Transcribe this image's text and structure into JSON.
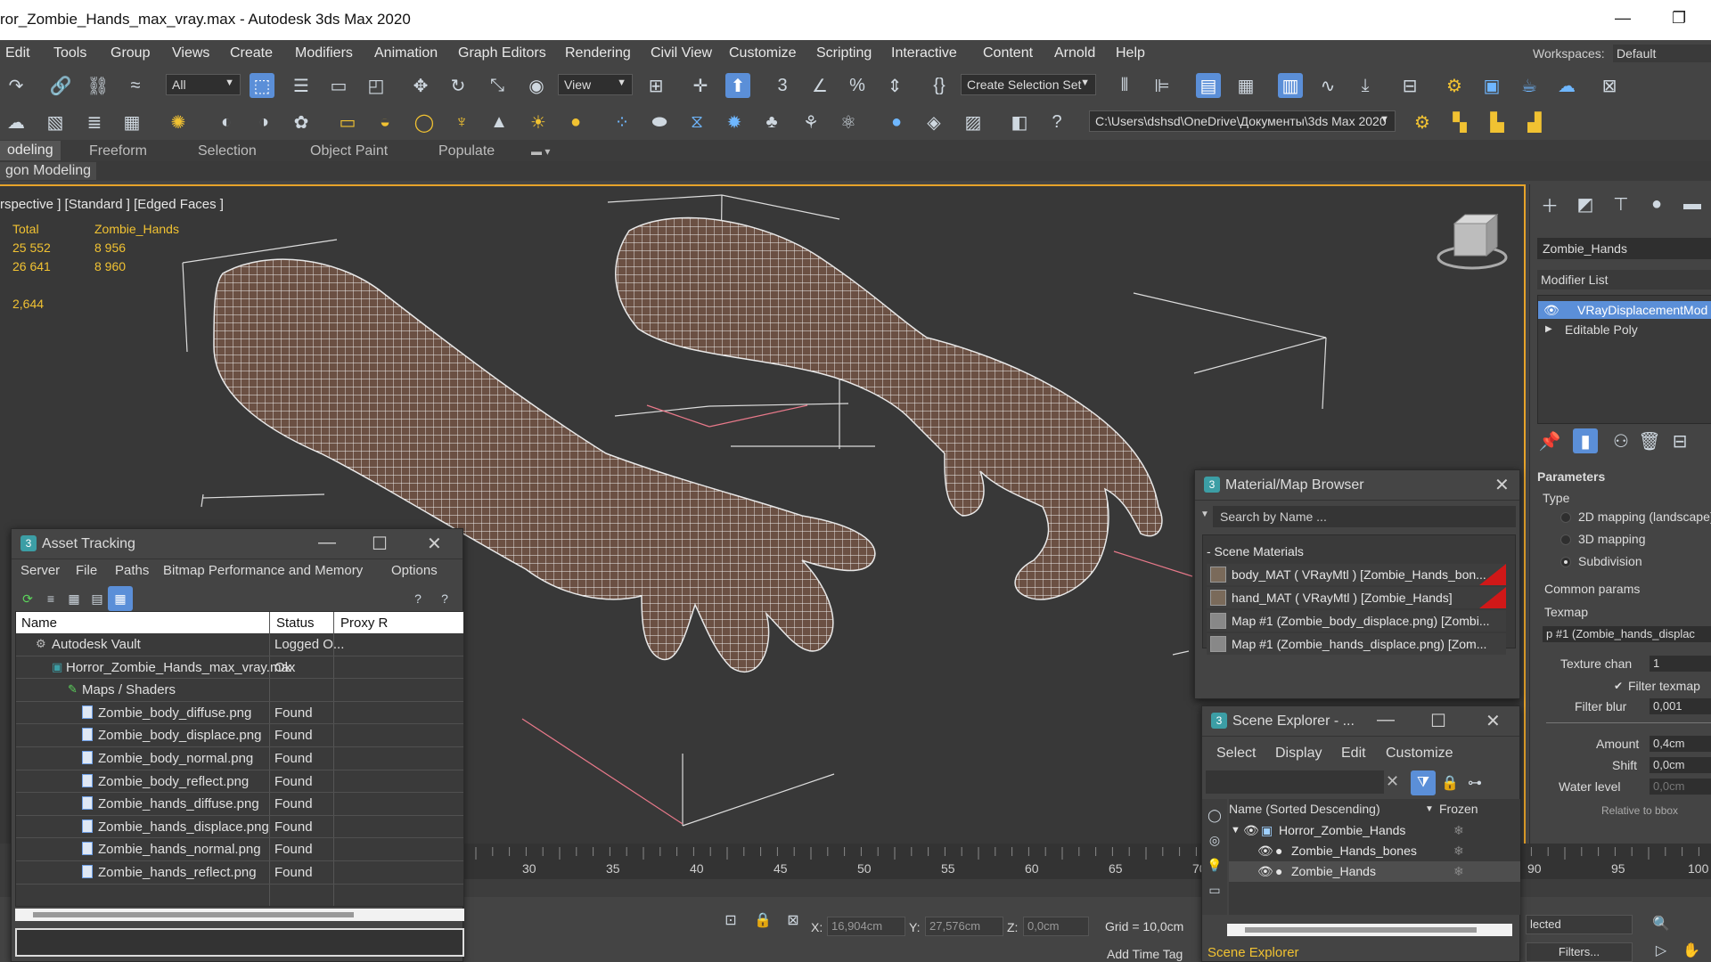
{
  "window": {
    "title": "ror_Zombie_Hands_max_vray.max - Autodesk 3ds Max 2020",
    "minimize": "—",
    "restore": "❐"
  },
  "menu": {
    "items": [
      "Edit",
      "Tools",
      "Group",
      "Views",
      "Create",
      "Modifiers",
      "Animation",
      "Graph Editors",
      "Rendering",
      "Civil View",
      "Customize",
      "Scripting",
      "Interactive",
      "Content",
      "Arnold",
      "Help"
    ],
    "workspaces_label": "Workspaces:",
    "workspaces_value": "Default"
  },
  "toolbar": {
    "filter_select": "All",
    "view_select": "View",
    "selection_set": "Create Selection Set",
    "project_path": "C:\\Users\\dshsd\\OneDrive\\Документы\\3ds Max 2020"
  },
  "ribbon": {
    "tabs": [
      "odeling",
      "Freeform",
      "Selection",
      "Object Paint",
      "Populate"
    ],
    "sub_label": "gon Modeling"
  },
  "viewport": {
    "label": "rspective ] [Standard ] [Edged Faces ]",
    "stats": {
      "col1_header": "Total",
      "col2_header": "Zombie_Hands",
      "row1_total": "25 552",
      "row1_obj": "8 956",
      "row2_total": "26 641",
      "row2_obj": "8 960",
      "fps": "2,644"
    }
  },
  "command_panel": {
    "object_name": "Zombie_Hands",
    "modifier_list": "Modifier List",
    "stack": [
      "VRayDisplacementMod",
      "Editable Poly"
    ],
    "parameters_title": "Parameters",
    "type_label": "Type",
    "type_options": [
      "2D mapping (landscape)",
      "3D mapping",
      "Subdivision"
    ],
    "common_params": "Common params",
    "texmap_label": "Texmap",
    "texmap_value": "p #1 (Zombie_hands_displac",
    "texture_chan_label": "Texture chan",
    "texture_chan_value": "1",
    "filter_texmap": "Filter texmap",
    "filter_blur_label": "Filter blur",
    "filter_blur_value": "0,001",
    "amount_label": "Amount",
    "amount_value": "0,4cm",
    "shift_label": "Shift",
    "shift_value": "0,0cm",
    "water_level_label": "Water level",
    "water_level_value": "0,0cm",
    "relative_label": "Relative to bbox"
  },
  "asset_tracking": {
    "title": "Asset Tracking",
    "menu": [
      "Server",
      "File",
      "Paths",
      "Bitmap Performance and Memory",
      "Options"
    ],
    "columns": [
      "Name",
      "Status",
      "Proxy R"
    ],
    "rows": [
      {
        "name": "Autodesk Vault",
        "status": "Logged O..."
      },
      {
        "name": "Horror_Zombie_Hands_max_vray.max",
        "status": "Ok"
      },
      {
        "name": "Maps / Shaders",
        "status": ""
      },
      {
        "name": "Zombie_body_diffuse.png",
        "status": "Found"
      },
      {
        "name": "Zombie_body_displace.png",
        "status": "Found"
      },
      {
        "name": "Zombie_body_normal.png",
        "status": "Found"
      },
      {
        "name": "Zombie_body_reflect.png",
        "status": "Found"
      },
      {
        "name": "Zombie_hands_diffuse.png",
        "status": "Found"
      },
      {
        "name": "Zombie_hands_displace.png",
        "status": "Found"
      },
      {
        "name": "Zombie_hands_normal.png",
        "status": "Found"
      },
      {
        "name": "Zombie_hands_reflect.png",
        "status": "Found"
      }
    ]
  },
  "material_browser": {
    "title": "Material/Map Browser",
    "search_placeholder": "Search by Name ...",
    "group": "- Scene Materials",
    "rows": [
      "body_MAT  ( VRayMtl )  [Zombie_Hands_bon...",
      "hand_MAT  ( VRayMtl )  [Zombie_Hands]",
      "Map  #1  (Zombie_body_displace.png)   [Zombi...",
      "Map  #1  (Zombie_hands_displace.png)   [Zom..."
    ]
  },
  "scene_explorer": {
    "title": "Scene Explorer - ...",
    "menu": [
      "Select",
      "Display",
      "Edit",
      "Customize"
    ],
    "col_name": "Name (Sorted Descending)",
    "col_frozen": "Frozen",
    "rows": [
      "Horror_Zombie_Hands",
      "Zombie_Hands_bones",
      "Zombie_Hands"
    ],
    "footer": "Scene Explorer"
  },
  "timeline": {
    "ticks": [
      "30",
      "35",
      "40",
      "45",
      "50",
      "55",
      "60",
      "65",
      "70",
      "90",
      "95",
      "100"
    ]
  },
  "status": {
    "x_label": "X:",
    "x_value": "16,904cm",
    "y_label": "Y:",
    "y_value": "27,576cm",
    "z_label": "Z:",
    "z_value": "0,0cm",
    "grid": "Grid = 10,0cm",
    "add_time_tag": "Add Time Tag",
    "selected": "lected",
    "filters": "Filters..."
  }
}
